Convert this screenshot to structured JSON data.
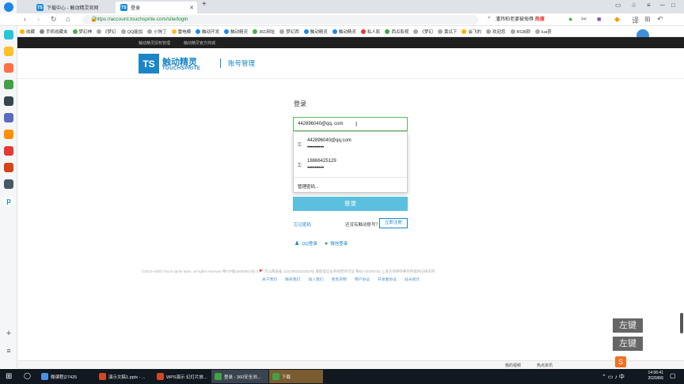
{
  "browser": {
    "tabs": [
      {
        "label": "下载中心 - 触动精灵官网",
        "icon": "TS"
      },
      {
        "label": "登录",
        "icon": "TS"
      }
    ],
    "new_tab": "+",
    "url": "https://account.touchsprite.com/site/login",
    "search_text": "潘玮柏老婆被侮辱",
    "search_badge": "热搜",
    "bookmarks": [
      "收藏",
      "手机收藏夹",
      "梦幻神",
      "《梦幻",
      "QQ能加",
      "小狗丁",
      "雷电模",
      "触动开发",
      "触动精灵",
      "361网址",
      "梦幻西",
      "触动精灵",
      "触动精灵",
      "私人影",
      "西瓜影视",
      "《梦幻",
      "黄瓜下",
      "会飞的",
      "欢迎您",
      "RGB颜",
      "lua获"
    ]
  },
  "site": {
    "top_links": [
      "触动精灵授权管理",
      "触动精灵官方商城"
    ],
    "logo_mark": "TS",
    "logo_cn": "触动精灵",
    "logo_en": "TOUCHSPRITE",
    "section": "账号管理"
  },
  "login": {
    "title": "登录",
    "account_value": "442896040@qq. com",
    "saved_accounts": [
      {
        "user": "442896040@qq.com",
        "password_mask": "•••••••••••••"
      },
      {
        "user": "18866425129",
        "password_mask": "•••••••••••••"
      }
    ],
    "manage_passwords": "管理密码...",
    "submit": "登录",
    "forgot": "忘记密码",
    "no_account": "还没有触动账号？",
    "register": "立即注册",
    "qq_login": "QQ登录",
    "wechat_login": "微信登录"
  },
  "footer": {
    "copyright": "©2013~2020 Touch sprite team. all rights reserved    粤ICP备15002601号-2  🚩 京公网安备 11010502033302号    增值电信业务经营许可证 粤B2-20180754    上海大师律师事务所提供法律支持",
    "links": [
      "关于我们",
      "联系我们",
      "加入我们",
      "免责声明",
      "用户协议",
      "开发者协议",
      "站长统计"
    ]
  },
  "overlay_keys": [
    "左键",
    "左键"
  ],
  "statusbar": {
    "items": [
      "我的视频",
      "热点资讯"
    ]
  },
  "taskbar": {
    "tasks": [
      "微课程|27425",
      "演示文稿1.pptx - ...",
      "WPS演示 幻灯片放...",
      "登录 - 360安全浏...",
      "下载"
    ],
    "time": "14:06:41",
    "date": "2020/8/6"
  },
  "colors": {
    "brand": "#1a86c6",
    "login_button": "#5bc0de",
    "input_focus": "#5cb85c"
  }
}
